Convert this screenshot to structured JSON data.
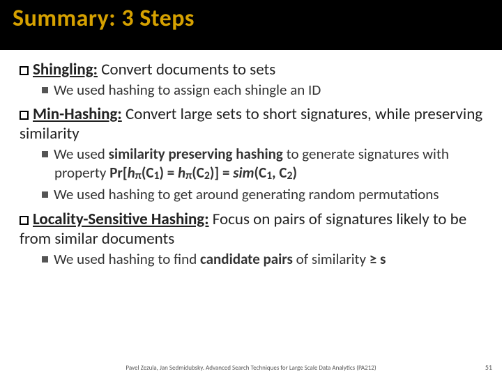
{
  "title": "Summary: 3 Steps",
  "steps": [
    {
      "term": "Shingling:",
      "desc": " Convert documents to sets",
      "subs": [
        "We used hashing to assign each shingle an ID"
      ]
    },
    {
      "term": "Min-Hashing:",
      "desc": " Convert large sets to short signatures, while preserving similarity",
      "subs": [
        "We used <b>similarity preserving hashing</b> to generate signatures with property <b>Pr[<i>h</i><span class=\"sub\">π</span>(C<span class=\"sub\">1</span>) = <i>h</i><span class=\"sub\">π</span>(C<span class=\"sub\">2</span>)] = <i>sim</i>(C<span class=\"sub\">1</span>, C<span class=\"sub\">2</span>)</b>",
        "We used hashing to get around generating random permutations"
      ]
    },
    {
      "term": "Locality-Sensitive Hashing:",
      "desc": " Focus on pairs of signatures likely to be from similar documents",
      "subs": [
        "We used hashing to find <b>candidate pairs</b> of similarity <b>≥ s</b>"
      ]
    }
  ],
  "footer": "Pavel Zezula, Jan Sedmidubsky. Advanced Search Techniques for Large Scale Data Analytics (PA212)",
  "page": "51"
}
